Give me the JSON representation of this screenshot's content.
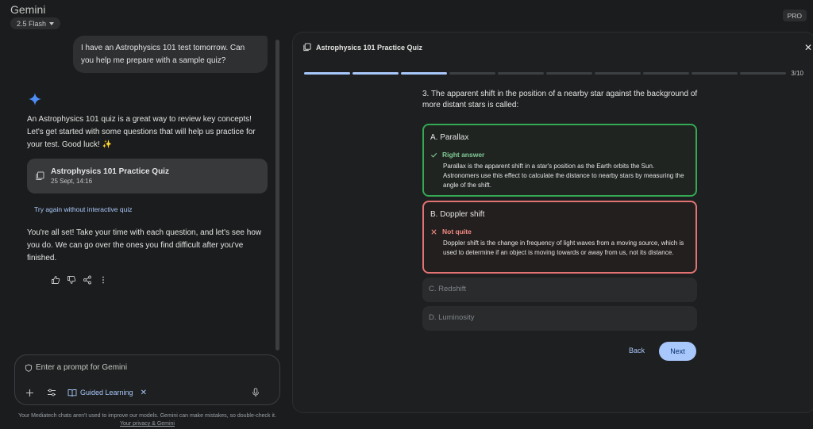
{
  "app": {
    "title": "Gemini",
    "model": "2.5 Flash",
    "badge": "PRO"
  },
  "chat": {
    "user_message": "I have an Astrophysics 101 test tomorrow. Can you help me prepare with a sample quiz?",
    "response_intro": "An Astrophysics 101 quiz is a great way to review key concepts! Let's get started with some questions that will help us practice for your test. Good luck! ✨",
    "quiz_card": {
      "title": "Astrophysics 101 Practice Quiz",
      "date": "25 Sept, 14:16"
    },
    "try_again": "Try again without interactive quiz",
    "response_outro": "You're all set! Take your time with each question, and let's see how you do. We can go over the ones you find difficult after you've finished."
  },
  "composer": {
    "placeholder": "Enter a prompt for Gemini",
    "guided_label": "Guided Learning",
    "disclaimer": "Your Mediatech chats aren't used to improve our models. Gemini can make mistakes, so double-check it.",
    "privacy_link": "Your privacy & Gemini"
  },
  "quiz": {
    "title": "Astrophysics 101 Practice Quiz",
    "progress_label": "3/10",
    "progress": {
      "current": 3,
      "total": 10
    },
    "question": "3. The apparent shift in the position of a nearby star against the background of more distant stars is called:",
    "options": [
      {
        "label": "A.  Parallax",
        "state": "correct",
        "verdict": "Right answer",
        "explanation": "Parallax is the apparent shift in a star's position as the Earth orbits the Sun. Astronomers use this effect to calculate the distance to nearby stars by measuring the angle of the shift."
      },
      {
        "label": "B.  Doppler shift",
        "state": "wrong",
        "verdict": "Not quite",
        "explanation": "Doppler shift is the change in frequency of light waves from a moving source, which is used to determine if an object is moving towards or away from us, not its distance."
      },
      {
        "label": "C.  Redshift",
        "state": "unselected"
      },
      {
        "label": "D.  Luminosity",
        "state": "unselected"
      }
    ],
    "back_label": "Back",
    "next_label": "Next"
  },
  "colors": {
    "accent": "#a8c7fa",
    "correct": "#34a853",
    "wrong": "#e37373"
  }
}
